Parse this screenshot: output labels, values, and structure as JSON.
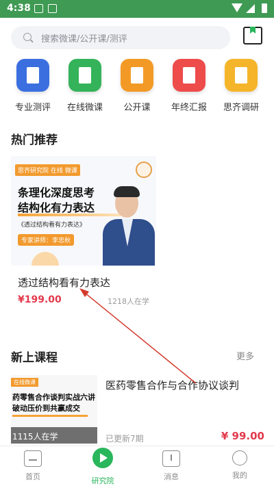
{
  "status_bar": {
    "time": "4:38"
  },
  "search": {
    "placeholder": "搜索微课/公开课/测评"
  },
  "categories": [
    {
      "label": "专业测评",
      "icon": "clipboard-icon",
      "color": "#3b6fe0"
    },
    {
      "label": "在线微课",
      "icon": "video-book-icon",
      "color": "#34b35a"
    },
    {
      "label": "公开课",
      "icon": "book-icon",
      "color": "#f39a26"
    },
    {
      "label": "年终汇报",
      "icon": "pen-icon",
      "color": "#ee4b4b"
    },
    {
      "label": "思齐调研",
      "icon": "columns-icon",
      "color": "#f5b52a"
    }
  ],
  "hot": {
    "section_title": "热门推荐",
    "card": {
      "banner_logo": "思齐研究院 在线 微课",
      "banner_heading_1": "条理化深度思考",
      "banner_heading_2": "结构化有力表达",
      "banner_sub": "《透过结构看有力表达》",
      "banner_tag": "专家讲师：李忠秋",
      "title": "透过结构看有力表达",
      "price": "¥199.00",
      "learners": "1218人在学"
    }
  },
  "new_courses": {
    "section_title": "新上课程",
    "more": "更多",
    "item": {
      "thumb_tag": "在线微课",
      "thumb_line_1": "药零售合作谈判实战六讲",
      "thumb_line_2": "破动压价到共赢成交",
      "count": "1115人在学",
      "title": "医药零售合作与合作协议谈判",
      "updated": "已更新7期",
      "price": "¥ 99.00"
    }
  },
  "tabbar": [
    {
      "label": "首页",
      "icon": "home-icon"
    },
    {
      "label": "研究院",
      "icon": "play-icon",
      "active": true
    },
    {
      "label": "消息",
      "icon": "message-icon"
    },
    {
      "label": "我的",
      "icon": "profile-icon"
    }
  ],
  "colors": {
    "accent": "#2ab65c",
    "price": "#e33a4d",
    "status_bar": "#3f9a54"
  }
}
